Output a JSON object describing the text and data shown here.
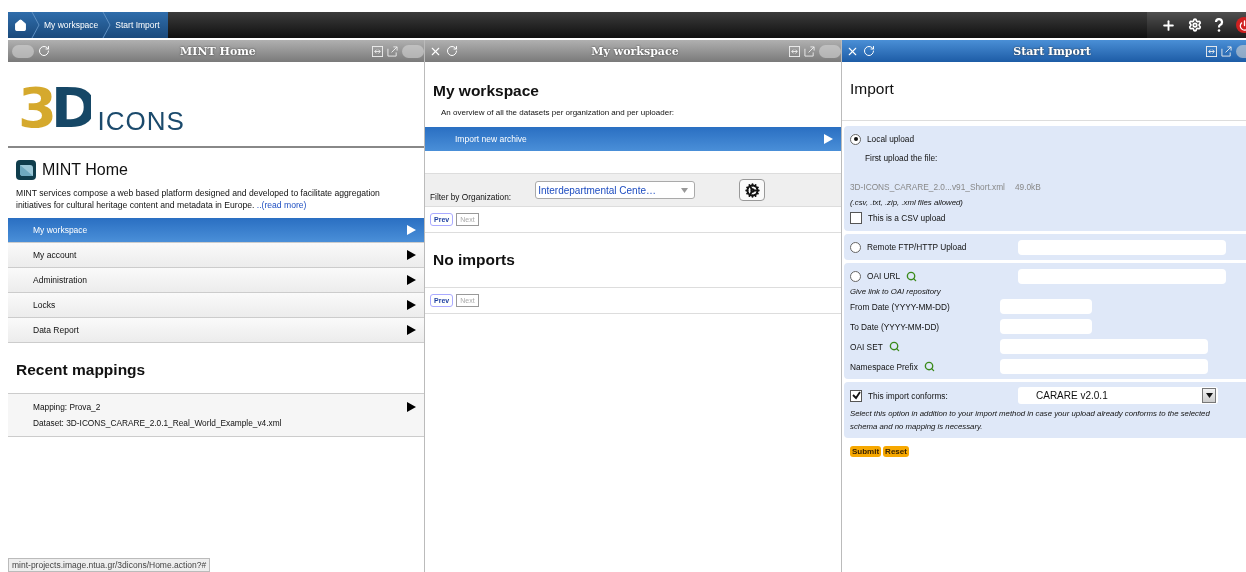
{
  "breadcrumbs": [
    {
      "label": "My workspace"
    },
    {
      "label": "Start Import"
    }
  ],
  "home_panel": {
    "header": {
      "title": "MINT Home",
      "active": false,
      "closable": false
    },
    "logo": {
      "mark": "3D",
      "word": "ICONS"
    },
    "heading": "MINT Home",
    "description": "MINT services compose a web based platform designed and developed to facilitate aggregation initiatives for cultural heritage content and metadata in Europe. ",
    "read_more": "..(read more)",
    "menu": [
      {
        "label": "My workspace",
        "selected": true
      },
      {
        "label": "My account",
        "selected": false
      },
      {
        "label": "Administration",
        "selected": false
      },
      {
        "label": "Locks",
        "selected": false
      },
      {
        "label": "Data Report",
        "selected": false
      }
    ],
    "recent_heading": "Recent mappings",
    "mappings": [
      {
        "mapping": "Mapping: Prova_2",
        "dataset": "Dataset: 3D-ICONS_CARARE_2.0.1_Real_World_Example_v4.xml"
      }
    ]
  },
  "workspace_panel": {
    "header": {
      "title": "My workspace",
      "active": false,
      "closable": true
    },
    "heading": "My workspace",
    "subtitle": "An overview of all the datasets per organization and per uploader:",
    "action": "Import new archive",
    "filter_label": "Filter by Organization:",
    "organization": "Interdepartmental Cente…",
    "pagers": [
      {
        "prev": "Prev",
        "next": "Next",
        "prev_disabled": false,
        "next_disabled": true
      },
      {
        "prev": "Prev",
        "next": "Next",
        "prev_disabled": false,
        "next_disabled": true
      }
    ],
    "empty": "No imports"
  },
  "import_panel": {
    "header": {
      "title": "Start Import",
      "active": true,
      "closable": true
    },
    "heading": "Import",
    "methods": [
      {
        "kind": "local",
        "label": "Local upload",
        "selected": true,
        "prompt": "First upload the file:",
        "file": "3D-ICONS_CARARE_2.0...v91_Short.xml",
        "size": "49.0kB",
        "hint": "(.csv, .txt, .zip, .xml files allowed)",
        "csv_label": "This is a CSV upload",
        "csv_checked": false
      },
      {
        "kind": "remote",
        "label": "Remote FTP/HTTP Upload",
        "selected": false
      },
      {
        "kind": "oai",
        "label": "OAI URL",
        "selected": false,
        "hint": "Give link to OAI repository",
        "fields": [
          {
            "label": "From Date (YYYY-MM-DD)",
            "lookup": false,
            "kind": "date"
          },
          {
            "label": "To Date (YYYY-MM-DD)",
            "lookup": false,
            "kind": "date"
          },
          {
            "label": "OAI SET",
            "lookup": true,
            "kind": "text"
          },
          {
            "label": "Namespace Prefix",
            "lookup": true,
            "kind": "text"
          }
        ]
      }
    ],
    "conforms": {
      "label": "This import conforms:",
      "checked": true,
      "schema": "CARARE v2.0.1",
      "note": "Select this option in addition to your import method in case your upload already conforms to the selected schema and no mapping is necessary."
    },
    "buttons": [
      {
        "label": "Submit"
      },
      {
        "label": "Reset"
      }
    ]
  },
  "status_url": "mint-projects.image.ntua.gr/3dicons/Home.action?#"
}
